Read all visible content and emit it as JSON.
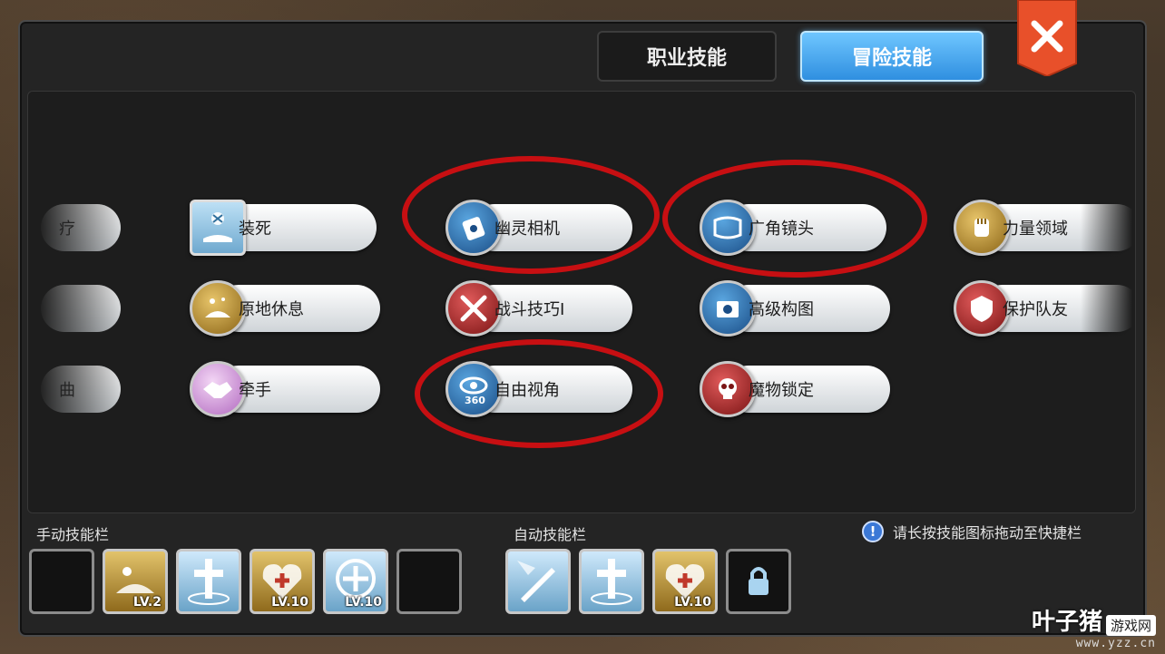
{
  "tabs": [
    {
      "label": "职业技能",
      "active": false
    },
    {
      "label": "冒险技能",
      "active": true
    }
  ],
  "close_icon": "close-icon",
  "skills": {
    "left_partial": [
      "疗",
      "",
      "曲"
    ],
    "items": [
      {
        "label": "装死",
        "icon": "play-dead-icon"
      },
      {
        "label": "幽灵相机",
        "icon": "ghost-camera-icon"
      },
      {
        "label": "广角镜头",
        "icon": "wide-angle-icon"
      },
      {
        "label": "力量领域",
        "icon": "fist-icon"
      },
      {
        "label": "原地休息",
        "icon": "rest-icon"
      },
      {
        "label": "战斗技巧I",
        "icon": "crossed-swords-icon"
      },
      {
        "label": "高级构图",
        "icon": "camera-icon"
      },
      {
        "label": "保护队友",
        "icon": "shield-icon"
      },
      {
        "label": "牵手",
        "icon": "handshake-icon"
      },
      {
        "label": "自由视角",
        "icon": "eye-360-icon",
        "badge": "360"
      },
      {
        "label": "魔物锁定",
        "icon": "skull-icon"
      }
    ]
  },
  "manual_bar": {
    "label": "手动技能栏",
    "slots": [
      {
        "type": "empty",
        "lv": ""
      },
      {
        "type": "gold",
        "lv": "LV.2"
      },
      {
        "type": "blue",
        "lv": ""
      },
      {
        "type": "gold",
        "lv": "LV.10"
      },
      {
        "type": "blue",
        "lv": "LV.10"
      },
      {
        "type": "empty",
        "lv": ""
      }
    ]
  },
  "auto_bar": {
    "label": "自动技能栏",
    "slots": [
      {
        "type": "blue",
        "lv": ""
      },
      {
        "type": "blue",
        "lv": ""
      },
      {
        "type": "gold",
        "lv": "LV.10"
      },
      {
        "type": "locked",
        "lv": ""
      }
    ]
  },
  "hint": {
    "icon": "!",
    "text": "请长按技能图标拖动至快捷栏"
  },
  "watermark": {
    "name": "叶子猪",
    "box": "游戏网",
    "url": "www.yzz.cn"
  },
  "colors": {
    "accent_blue": "#2f8fe0",
    "highlight_red": "#c70f12",
    "close_orange": "#e8502a"
  }
}
